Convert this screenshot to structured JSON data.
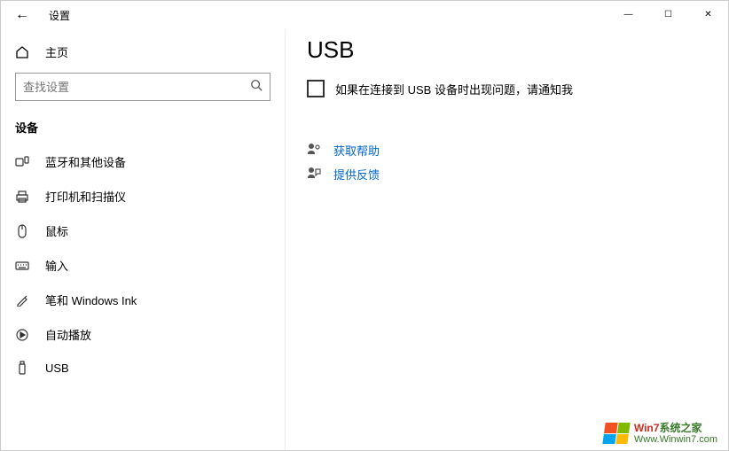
{
  "window": {
    "title": "设置",
    "controls": {
      "min": "—",
      "max": "☐",
      "close": "✕"
    }
  },
  "sidebar": {
    "home_label": "主页",
    "search_placeholder": "查找设置",
    "section_header": "设备",
    "items": [
      {
        "label": "蓝牙和其他设备"
      },
      {
        "label": "打印机和扫描仪"
      },
      {
        "label": "鼠标"
      },
      {
        "label": "输入"
      },
      {
        "label": "笔和 Windows Ink"
      },
      {
        "label": "自动播放"
      },
      {
        "label": "USB"
      }
    ]
  },
  "main": {
    "page_title": "USB",
    "checkbox_label": "如果在连接到 USB 设备时出现问题，请通知我",
    "links": {
      "help": "获取帮助",
      "feedback": "提供反馈"
    }
  },
  "watermark": {
    "line1a": "Win7",
    "line1b": "系统之家",
    "line2": "Www.Winwin7.com"
  }
}
